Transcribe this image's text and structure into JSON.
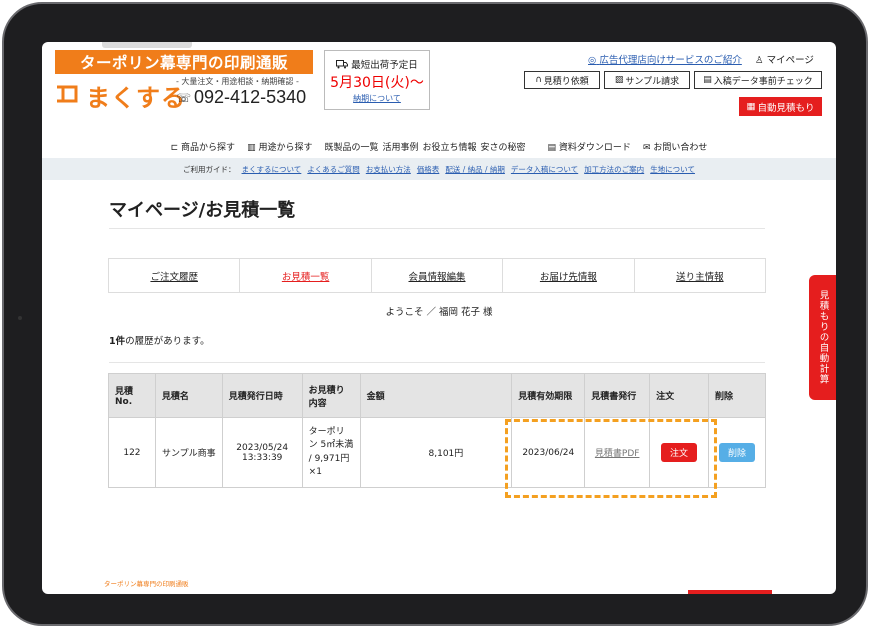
{
  "header": {
    "banner": "ターポリン幕専門の印刷通販",
    "logo_name": "まくする",
    "tagline": "- 大量注文・用途相談・納期確認 -",
    "phone": "092-412-5340",
    "ship_label": "最短出荷予定日",
    "ship_date": "5月30日(火)〜",
    "ship_link": "納期について",
    "agency_link": "広告代理店向けサービスのご紹介",
    "mypage": "マイページ",
    "buttons": [
      "見積り依頼",
      "サンプル請求",
      "入稿データ事前チェック"
    ],
    "auto_estimate": "自動見積もり"
  },
  "nav": {
    "items": [
      "商品から探す",
      "用途から探す",
      "既製品の一覧",
      "活用事例",
      "お役立ち情報",
      "安さの秘密",
      "資料ダウンロード",
      "お問い合わせ"
    ]
  },
  "guide": {
    "label": "ご利用ガイド：",
    "links": [
      "まくするについて",
      "よくあるご質問",
      "お支払い方法",
      "価格表",
      "配送 / 納品 / 納期",
      "データ入稿について",
      "加工方法のご案内",
      "生地について"
    ]
  },
  "page": {
    "title": "マイページ/お見積一覧",
    "tabs": [
      "ご注文履歴",
      "お見積一覧",
      "会員情報編集",
      "お届け先情報",
      "送り主情報"
    ],
    "welcome": "ようこそ ／ 福岡 花子 様",
    "count_num": "1件",
    "count_text": "の履歴があります。"
  },
  "table": {
    "headers": [
      "見積No.",
      "見積名",
      "見積発行日時",
      "お見積り内容",
      "金額",
      "見積有効期限",
      "見積書発行",
      "注文",
      "削除"
    ],
    "rows": [
      {
        "no": "122",
        "name": "サンプル商事",
        "issued": "2023/05/24 13:33:39",
        "content": "ターポリン 5㎡未満 / 9,971円 ×1",
        "amount": "8,101円",
        "expiry": "2023/06/24",
        "pdf": "見積書PDF",
        "order": "注文",
        "delete": "削除"
      }
    ]
  },
  "side_tab": "見積もりの自動計算",
  "footer": {
    "brand": "ターポリン幕専門の印刷通販"
  },
  "colors": {
    "brand_orange": "#f07d1a",
    "accent_red": "#e51e1e",
    "link_blue": "#2a5db0",
    "highlight": "#f4a020",
    "delete_blue": "#56aee6"
  }
}
